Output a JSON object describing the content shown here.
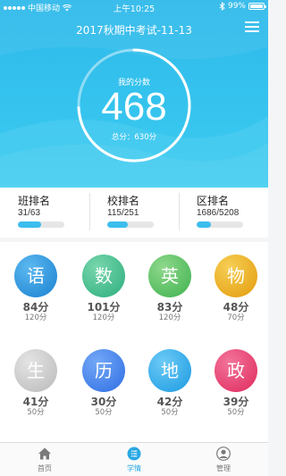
{
  "status_bar": {
    "carrier": "中国移动",
    "time": "上午10:25",
    "battery": "99%",
    "battery_level": 0.99
  },
  "header": {
    "title": "2017秋期中考试-11-13",
    "score_label": "我的分数",
    "score": "468",
    "total": "总分：630分",
    "score_fraction": 0.743
  },
  "ranks": [
    {
      "title": "班排名",
      "value": "31/63",
      "fraction": 0.5
    },
    {
      "title": "校排名",
      "value": "115/251",
      "fraction": 0.45
    },
    {
      "title": "区排名",
      "value": "1686/5208",
      "fraction": 0.3
    }
  ],
  "subjects": [
    {
      "char": "语",
      "score": "84分",
      "full": "120分",
      "color": "#2a8fd8",
      "color2": "#5cb8f0"
    },
    {
      "char": "数",
      "score": "101分",
      "full": "120分",
      "color": "#3fb889",
      "color2": "#78d6ac"
    },
    {
      "char": "英",
      "score": "83分",
      "full": "120分",
      "color": "#52bb5e",
      "color2": "#8fd88c"
    },
    {
      "char": "物",
      "score": "48分",
      "full": "70分",
      "color": "#e8a81e",
      "color2": "#f6cf55"
    },
    {
      "char": "生",
      "score": "41分",
      "full": "50分",
      "color": "#c4c4c4",
      "color2": "#e4e4e4"
    },
    {
      "char": "历",
      "score": "30分",
      "full": "50分",
      "color": "#3f7ce8",
      "color2": "#74a8f6"
    },
    {
      "char": "地",
      "score": "42分",
      "full": "50分",
      "color": "#2fa6e6",
      "color2": "#6ccaf6"
    },
    {
      "char": "政",
      "score": "39分",
      "full": "50分",
      "color": "#e43c6c",
      "color2": "#f2749a"
    }
  ],
  "tabs": [
    {
      "label": "首页",
      "icon": "home-icon",
      "active": false
    },
    {
      "label": "学情",
      "icon": "list-icon",
      "active": true
    },
    {
      "label": "管理",
      "icon": "user-icon",
      "active": false
    }
  ],
  "colors": {
    "header_top": "#2fb9ea",
    "header_bottom": "#3cccf0",
    "accent": "#2aa8e3",
    "rank_bar": "#3cbdee"
  }
}
